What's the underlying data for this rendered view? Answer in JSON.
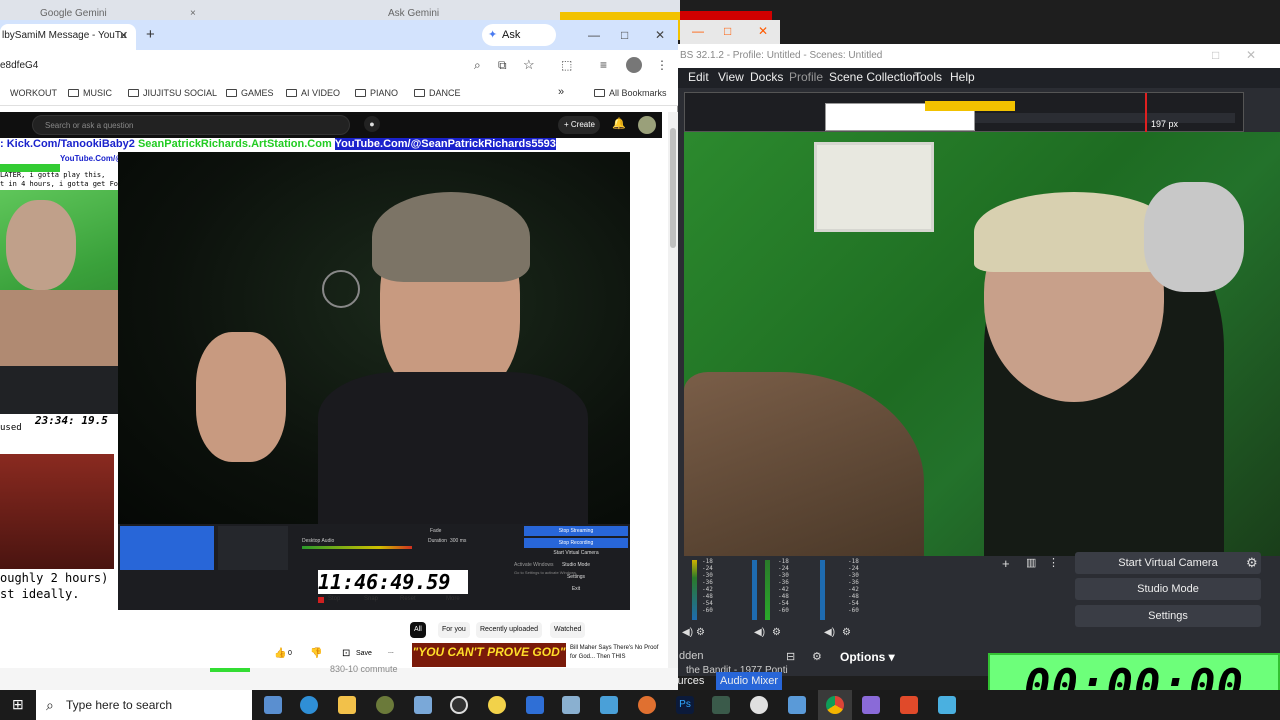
{
  "background": {
    "ghost_tab_1": "Google Gemini",
    "ghost_tab_2": "Ask Gemini",
    "ghost_close": "×"
  },
  "browser": {
    "tab_title": "lbySamiM Message - YouTu",
    "new_tab": "+",
    "ask_gemini": "Ask Gemini",
    "address": "e8dfeG4",
    "bookmarks": [
      "WORKOUT",
      "MUSIC",
      "JIUJITSU SOCIAL",
      "GAMES",
      "AI VIDEO",
      "PIANO",
      "DANCE"
    ],
    "all_bookmarks": "All Bookmarks",
    "bookmarks_overflow": "»",
    "win_min": "—",
    "win_max": "□",
    "win_close": "✕"
  },
  "youtube": {
    "search_placeholder": "Search or ask a question",
    "create": "Create",
    "links": {
      "kick": ": Kick.Com/TanookiBaby2",
      "artstation": "SeanPatrickRichards.ArtStation.Com",
      "youtube": "YouTube.Com/@SeanPatrickRichards5593",
      "youtube_small": "YouTube.Com/@"
    },
    "side_text_1": "LATER, i gotta play this,",
    "side_text_2": "t in 4 hours, i gotta get Focuse",
    "focused_label": "used",
    "mini_clock": "23:34: 19.5",
    "big_clock": "11:46:49.59",
    "caption_line_1": "oughly 2 hours)",
    "caption_line_2": "st ideally.",
    "big_clock_buttons": [
      "Stop",
      "Snap",
      "Reset",
      "More"
    ],
    "mini_obs": {
      "stop_streaming": "Stop Streaming",
      "stop_recording": "Stop Recording",
      "start_virtual": "Start Virtual Camera",
      "studio_mode": "Studio Mode",
      "settings": "Settings",
      "exit": "Exit",
      "desktop_audio": "Desktop Audio",
      "fade": "Fade",
      "duration": "Duration",
      "duration_val": "300 ms",
      "activate_windows": "Activate Windows",
      "activate_sub": "Go to Settings to activate Windows."
    },
    "chips": [
      "All",
      "For you",
      "Recently uploaded",
      "Watched"
    ],
    "like_count": "0",
    "save": "Save",
    "more": "...",
    "thumb_text": "\"YOU CAN'T PROVE GOD\"",
    "related_title": "Bill Maher Says There's No Proof for God... Then THIS"
  },
  "obs": {
    "title": "BS 32.1.2 - Profile: Untitled - Scenes: Untitled",
    "menu": [
      "Edit",
      "View",
      "Docks",
      "Profile",
      "Scene Collection",
      "Tools",
      "Help"
    ],
    "preview_px": "197 px",
    "buttons": {
      "start_virtual_camera": "Start Virtual Camera",
      "studio_mode": "Studio Mode",
      "settings": "Settings"
    },
    "tabs": [
      "Sources",
      "Audio Mixer"
    ],
    "options": "Options",
    "hidden_label": "dden",
    "meter_scale": [
      "-18",
      "-24",
      "-30",
      "-36",
      "-42",
      "-48",
      "-54",
      "-60"
    ],
    "timer": "00:00:00",
    "ghost_row_1": "830-10 commute",
    "ghost_row_2": "the Bandit - 1977 Ponti"
  },
  "taskbar": {
    "search_placeholder": "Type here to search"
  },
  "colors": {
    "accent_link_red": "#cc0000",
    "accent_link_green": "#22cc22",
    "accent_link_blue": "#1a22cc",
    "obs_bg": "#2b2d33",
    "timer_green": "#6dff7a",
    "obs_blue": "#2866d8"
  }
}
